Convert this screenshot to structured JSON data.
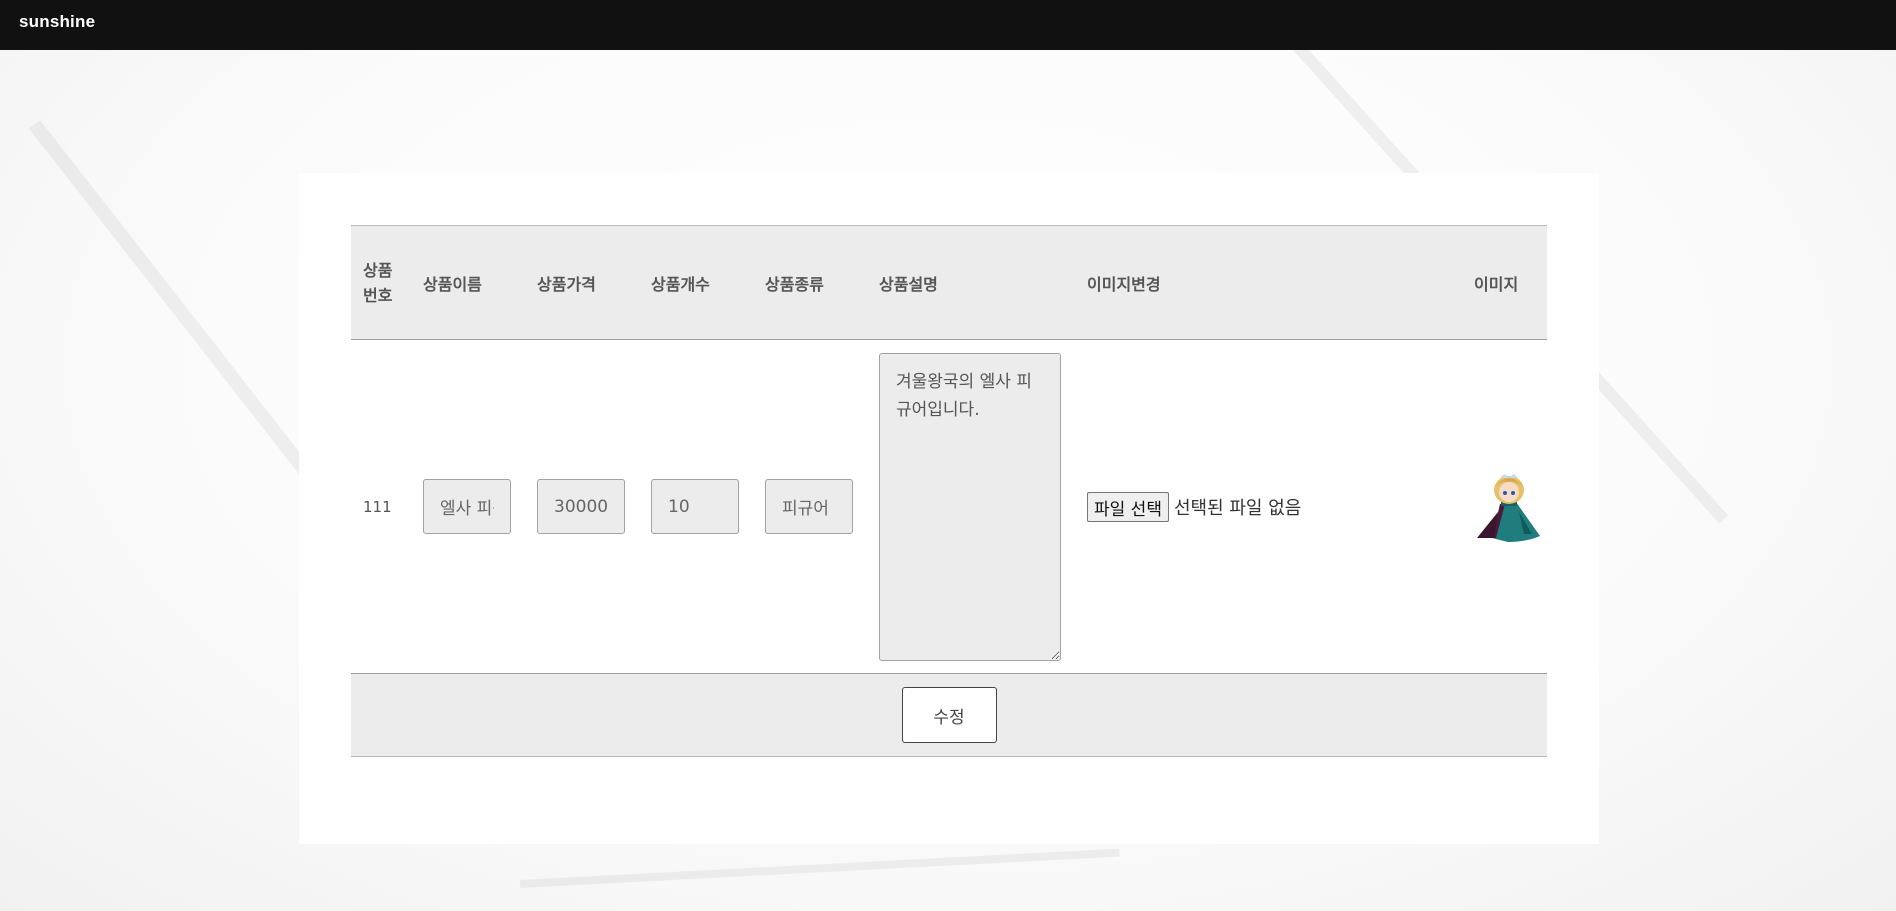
{
  "navbar": {
    "brand": "sunshine"
  },
  "table": {
    "headers": {
      "no": "상품번호",
      "name": "상품이름",
      "price": "상품가격",
      "count": "상품개수",
      "type": "상품종류",
      "desc": "상품설명",
      "change_image": "이미지변경",
      "image": "이미지"
    },
    "row": {
      "no": "111",
      "name": "엘사 피규어",
      "price": "30000",
      "count": "10",
      "type": "피규어",
      "desc": "겨울왕국의 엘사 피규어입니다.",
      "file_button": "파일 선택",
      "file_status": "선택된 파일 없음",
      "image_icon": "elsa-figure-image"
    },
    "submit_label": "수정"
  },
  "colors": {
    "navbar_bg": "#111111",
    "header_bg": "#ececec",
    "field_bg": "#ececec"
  }
}
